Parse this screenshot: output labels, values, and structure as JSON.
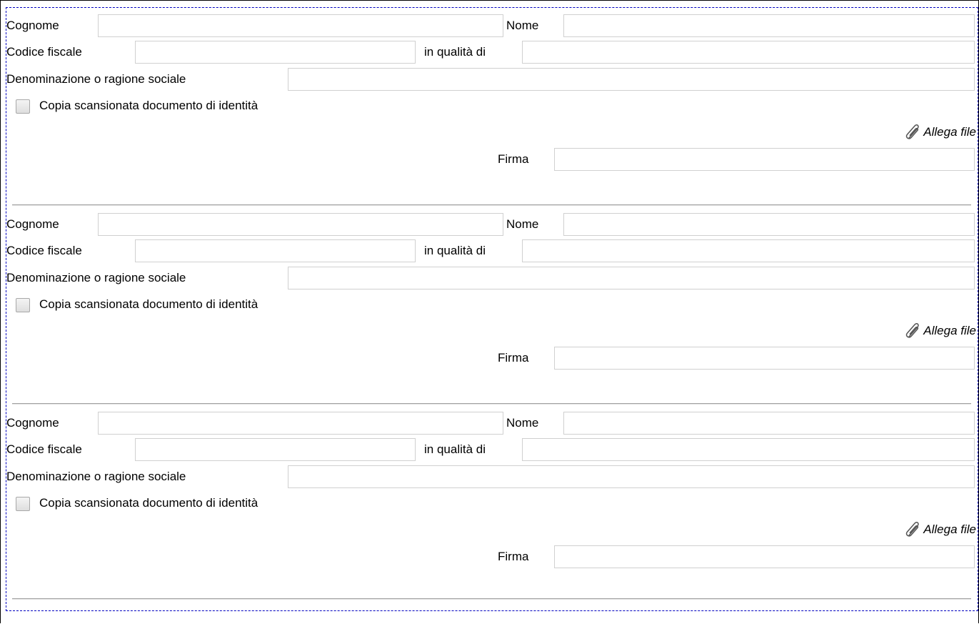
{
  "labels": {
    "surname": "Cognome",
    "name": "Nome",
    "tax_code": "Codice fiscale",
    "role": "in qualità di",
    "company": "Denominazione o ragione sociale",
    "id_document": "Copia scansionata documento di identità",
    "attach": "Allega file",
    "signature": "Firma"
  },
  "signers": [
    {
      "surname": "",
      "name": "",
      "tax_code": "",
      "role": "",
      "company": "",
      "id_document_checked": false,
      "signature": ""
    },
    {
      "surname": "",
      "name": "",
      "tax_code": "",
      "role": "",
      "company": "",
      "id_document_checked": false,
      "signature": ""
    },
    {
      "surname": "",
      "name": "",
      "tax_code": "",
      "role": "",
      "company": "",
      "id_document_checked": false,
      "signature": ""
    }
  ],
  "icons": {
    "attach": "paperclip-icon"
  },
  "colors": {
    "container_border": "#0000c0",
    "field_border": "#d0d0d0",
    "separator": "#a0a0a0"
  }
}
